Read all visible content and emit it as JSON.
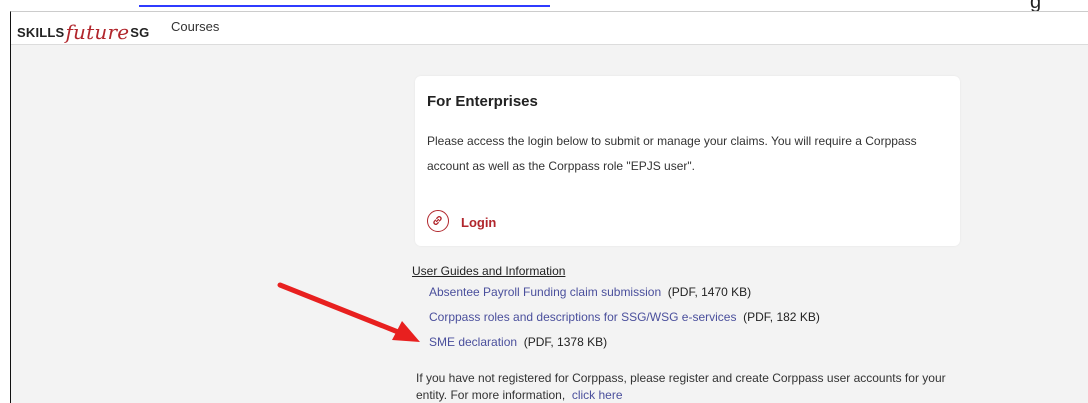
{
  "navbar": {
    "logo": {
      "part1": "SKILLS",
      "part2": "future",
      "part3": "SG"
    },
    "courses_label": "Courses"
  },
  "top_fragment": "g",
  "card": {
    "title": "For Enterprises",
    "description": "Please access the login below to submit or manage your claims. You will require a Corppass account as well as the Corppass role \"EPJS user\".",
    "login_label": "Login"
  },
  "guides": {
    "heading": "User Guides and Information",
    "items": [
      {
        "label": "Absentee Payroll Funding claim submission",
        "meta": "(PDF, 1470 KB)"
      },
      {
        "label": "Corppass roles and descriptions for SSG/WSG e-services",
        "meta": "(PDF, 182 KB)"
      },
      {
        "label": "SME declaration",
        "meta": "(PDF, 1378 KB)"
      }
    ]
  },
  "register": {
    "text": "If you have not registered for Corppass, please register and create Corppass user accounts for your entity. For more information,",
    "link_label": "click here"
  },
  "colors": {
    "brand_red": "#b1262c",
    "link_blue": "#4a4f9c",
    "arrow_red": "#e8201f"
  },
  "icons": {
    "login": "link-icon",
    "annotation": "red-arrow-annotation"
  }
}
